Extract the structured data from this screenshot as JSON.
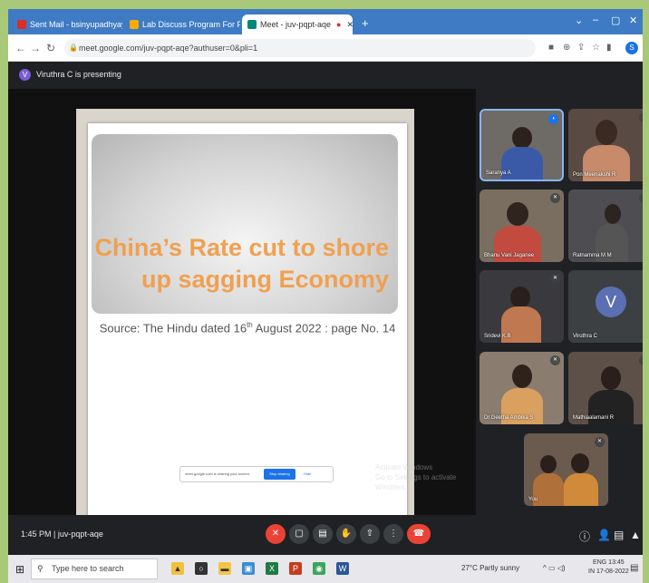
{
  "browser": {
    "tabs": [
      {
        "label": "Sent Mail - bsinyupadhyay@stcr",
        "favicon_color": "#d93025"
      },
      {
        "label": "Lab Discuss Program For Faculty",
        "favicon_color": "#f9ab00"
      },
      {
        "label": "Meet - juv-pqpt-aqe",
        "favicon_color": "#00897b",
        "active": true
      }
    ],
    "new_tab": "+",
    "url": "meet.google.com/juv-pqpt-aqe?authuser=0&pli=1"
  },
  "presenting": {
    "avatar_letter": "V",
    "text": "Viruthra C is presenting"
  },
  "slide": {
    "title_line1": "China’s Rate cut to shore",
    "title_line2": "up sagging Economy",
    "source_prefix": "Source: The Hindu dated 16",
    "source_sup": "th",
    "source_suffix": " August 2022 : page No. 14",
    "share_notice": "meet.google.com is sharing your screen.",
    "stop_sharing": "Stop sharing",
    "hide": "Hide",
    "activate_line1": "Activate Windows",
    "activate_line2": "Go to Settings to activate Windows."
  },
  "participants": [
    {
      "name": "Saranya A",
      "bg": "#6e6a66"
    },
    {
      "name": "Pon Meenakshi R",
      "bg": "#5a4a44"
    },
    {
      "name": "Bhanu Vani Jaganee",
      "bg": "#7a6e60"
    },
    {
      "name": "Ratnamma M M",
      "bg": "#4d4d52"
    },
    {
      "name": "Sridevi K.B",
      "bg": "#3a3a3e"
    },
    {
      "name": "Viruthra C",
      "bg": "#3c4043",
      "letter": "V"
    },
    {
      "name": "Dr.Geetha Ambika S",
      "bg": "#8a7d70"
    },
    {
      "name": "Mathiaalamani R",
      "bg": "#5c5048"
    },
    {
      "name": "You",
      "bg": "#6b5a4e"
    }
  ],
  "meeting": {
    "time": "1:45 PM",
    "separator": "|",
    "code": "juv-pqpt-aqe"
  },
  "taskbar": {
    "search_placeholder": "Type here to search",
    "weather": "27°C  Partly sunny",
    "lang": "ENG",
    "region": "IN",
    "time": "13:45",
    "date": "17-08-2022"
  },
  "colors": {
    "title_orange": "#f0a050",
    "meet_bg": "#202124",
    "end_call_red": "#ea4335",
    "chrome_blue": "#3e7bc4"
  }
}
